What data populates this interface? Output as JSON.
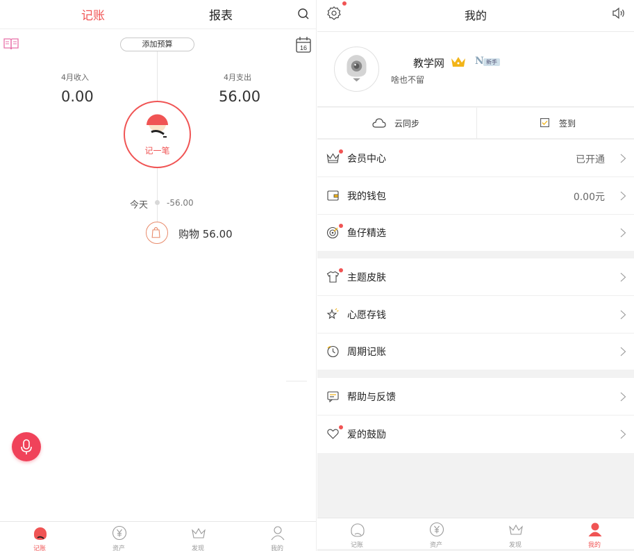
{
  "left": {
    "header": {
      "tab_active": "记账",
      "tab_report": "报表"
    },
    "budget_button": "添加预算",
    "calendar_day": "16",
    "income": {
      "label": "4月收入",
      "value": "0.00"
    },
    "expense": {
      "label": "4月支出",
      "value": "56.00"
    },
    "record_button": "记一笔",
    "today": {
      "label": "今天",
      "amount": "-56.00"
    },
    "entry": {
      "text": "购物 56.00"
    },
    "tabs": [
      {
        "label": "记账",
        "icon": "ledger-icon",
        "active": true
      },
      {
        "label": "资产",
        "icon": "yuan-icon",
        "active": false
      },
      {
        "label": "发现",
        "icon": "crown-icon",
        "active": false
      },
      {
        "label": "我的",
        "icon": "person-icon",
        "active": false
      }
    ]
  },
  "right": {
    "header": {
      "title": "我的"
    },
    "profile": {
      "username": "教学网",
      "badge": "新手",
      "bio": "啥也不留"
    },
    "sync": {
      "cloud": "云同步",
      "checkin": "签到"
    },
    "menu": [
      {
        "label": "会员中心",
        "value": "已开通",
        "icon": "crown-outline-icon",
        "dot": true
      },
      {
        "label": "我的钱包",
        "value": "0.00元",
        "icon": "wallet-icon",
        "dot": false
      },
      {
        "label": "鱼仔精选",
        "value": "",
        "icon": "target-icon",
        "dot": true
      },
      {
        "label": "主题皮肤",
        "value": "",
        "icon": "shirt-icon",
        "dot": true
      },
      {
        "label": "心愿存钱",
        "value": "",
        "icon": "sparkle-icon",
        "dot": false
      },
      {
        "label": "周期记账",
        "value": "",
        "icon": "clock-icon",
        "dot": false
      },
      {
        "label": "帮助与反馈",
        "value": "",
        "icon": "message-icon",
        "dot": false
      },
      {
        "label": "爱的鼓励",
        "value": "",
        "icon": "heart-icon",
        "dot": true
      }
    ],
    "tabs": [
      {
        "label": "记账",
        "icon": "ledger-icon",
        "active": false
      },
      {
        "label": "资产",
        "icon": "yuan-icon",
        "active": false
      },
      {
        "label": "发现",
        "icon": "crown-icon",
        "active": false
      },
      {
        "label": "我的",
        "icon": "person-icon",
        "active": true
      }
    ]
  },
  "colors": {
    "accent": "#f05454",
    "mic": "#f0425a",
    "crown": "#f2b418",
    "text": "#222222",
    "muted": "#999999"
  }
}
